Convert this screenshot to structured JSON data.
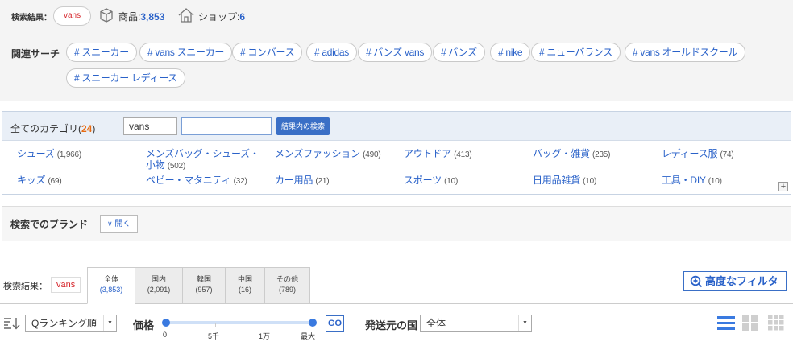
{
  "summary": {
    "label": "検索結果：",
    "keyword": "vans",
    "products_label": "商品:",
    "products_count": "3,853",
    "shops_label": "ショップ:",
    "shops_count": "6"
  },
  "related": {
    "label": "関連サーチ",
    "chips": [
      "# スニーカー",
      "# vans スニーカー",
      "# コンバース",
      "# adidas",
      "# バンズ vans",
      "# バンズ",
      "# nike",
      "# ニューバランス",
      "# vans オールドスクール",
      "# スニーカー レディース"
    ]
  },
  "categories": {
    "title": "全てのカテゴリ(",
    "count": "24",
    "title_close": ")",
    "search_value": "vans",
    "refine_value": "",
    "search_in_button": "結果内の検索",
    "items": [
      {
        "name": "シューズ",
        "count": "(1,966)"
      },
      {
        "name": "メンズバッグ・シューズ・小物",
        "count": "(502)"
      },
      {
        "name": "メンズファッション",
        "count": "(490)"
      },
      {
        "name": "アウトドア",
        "count": "(413)"
      },
      {
        "name": "バッグ・雑貨",
        "count": "(235)"
      },
      {
        "name": "レディース服",
        "count": "(74)"
      },
      {
        "name": "キッズ",
        "count": "(69)"
      },
      {
        "name": "ベビー・マタニティ",
        "count": "(32)"
      },
      {
        "name": "カー用品",
        "count": "(21)"
      },
      {
        "name": "スポーツ",
        "count": "(10)"
      },
      {
        "name": "日用品雑貨",
        "count": "(10)"
      },
      {
        "name": "工具・DIY",
        "count": "(10)"
      }
    ],
    "expand_symbol": "+"
  },
  "brand": {
    "label": "検索でのブランド",
    "open_button": "開く"
  },
  "results": {
    "label": "検索結果：",
    "keyword": "vans",
    "tabs": [
      {
        "label": "全体",
        "count": "(3,853)"
      },
      {
        "label": "国内",
        "count": "(2,091)"
      },
      {
        "label": "韓国",
        "count": "(957)"
      },
      {
        "label": "中国",
        "count": "(16)"
      },
      {
        "label": "その他",
        "count": "(789)"
      }
    ],
    "advanced_filter": "高度なフィルタ"
  },
  "filters": {
    "sort_value": "Qランキング順",
    "price_label": "価格",
    "price_ticks": [
      "0",
      "5千",
      "1万",
      "最大"
    ],
    "price_range": [
      0,
      1
    ],
    "go_button": "GO",
    "country_label": "発送元の国",
    "country_value": "全体"
  },
  "colors": {
    "accent": "#2a62c9",
    "keyword": "#d6262c",
    "count_orange": "#e86a10"
  }
}
